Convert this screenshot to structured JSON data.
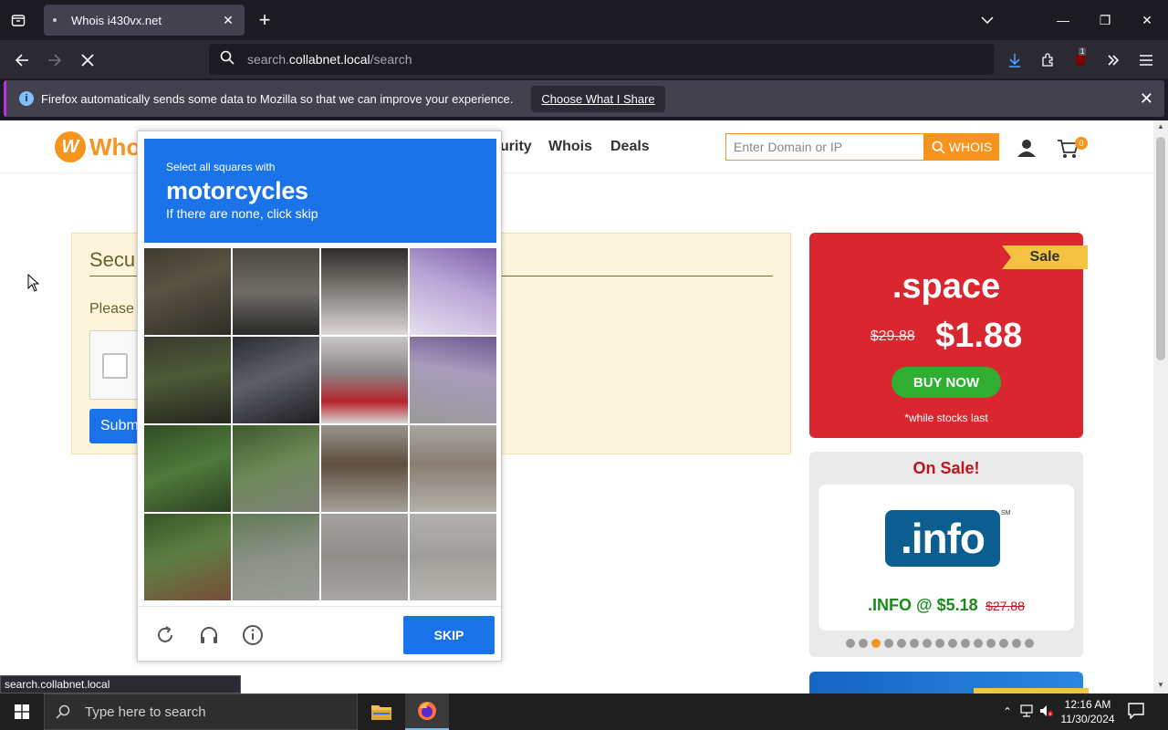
{
  "browser": {
    "tab_title": "Whois i430vx.net",
    "url_prefix": "search.",
    "url_domain": "collabnet.local",
    "url_path": "/search",
    "notification": {
      "text": "Firefox automatically sends some data to Mozilla so that we can improve your experience.",
      "button": "Choose What I Share"
    },
    "extension_badge": "1",
    "status_url": "search.collabnet.local"
  },
  "site": {
    "logo_text": "Who",
    "nav": [
      "urity",
      "Whois",
      "Deals"
    ],
    "search_placeholder": "Enter Domain or IP",
    "search_button": "WHOIS",
    "cart_count": "0"
  },
  "security_panel": {
    "heading": "Secu",
    "prompt": "Please",
    "submit_label": "Subm"
  },
  "captcha": {
    "instruction_line1": "Select all squares with",
    "target": "motorcycles",
    "instruction_line3": "If there are none, click skip",
    "grid_rows": 4,
    "grid_cols": 4,
    "skip_label": "SKIP"
  },
  "promos": {
    "space": {
      "ribbon": "Sale",
      "tld": ".space",
      "old_price": "$29.88",
      "new_price": "$1.88",
      "button": "BUY NOW",
      "note": "*while stocks last"
    },
    "info": {
      "heading": "On Sale!",
      "logo": ".info",
      "logo_mark": "SM",
      "price": ".INFO @ $5.18",
      "old_price": "$27.88",
      "carousel_dots": 15,
      "active_dot": 2
    }
  },
  "taskbar": {
    "search_placeholder": "Type here to search",
    "time": "12:16 AM",
    "date": "11/30/2024"
  },
  "colors": {
    "accent_orange": "#f7941d",
    "captcha_blue": "#1a73e8",
    "promo_red": "#d9262f"
  }
}
